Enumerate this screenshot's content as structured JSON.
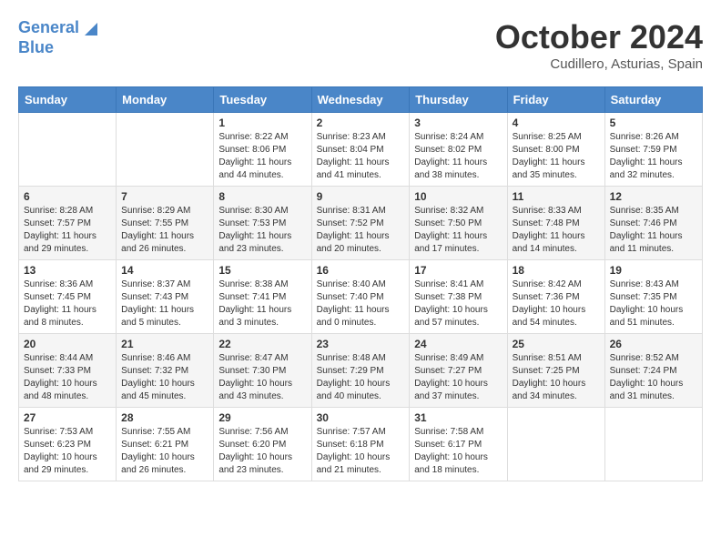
{
  "header": {
    "logo_line1": "General",
    "logo_line2": "Blue",
    "month_title": "October 2024",
    "location": "Cudillero, Asturias, Spain"
  },
  "days_of_week": [
    "Sunday",
    "Monday",
    "Tuesday",
    "Wednesday",
    "Thursday",
    "Friday",
    "Saturday"
  ],
  "weeks": [
    [
      {
        "day": "",
        "info": ""
      },
      {
        "day": "",
        "info": ""
      },
      {
        "day": "1",
        "info": "Sunrise: 8:22 AM\nSunset: 8:06 PM\nDaylight: 11 hours and 44 minutes."
      },
      {
        "day": "2",
        "info": "Sunrise: 8:23 AM\nSunset: 8:04 PM\nDaylight: 11 hours and 41 minutes."
      },
      {
        "day": "3",
        "info": "Sunrise: 8:24 AM\nSunset: 8:02 PM\nDaylight: 11 hours and 38 minutes."
      },
      {
        "day": "4",
        "info": "Sunrise: 8:25 AM\nSunset: 8:00 PM\nDaylight: 11 hours and 35 minutes."
      },
      {
        "day": "5",
        "info": "Sunrise: 8:26 AM\nSunset: 7:59 PM\nDaylight: 11 hours and 32 minutes."
      }
    ],
    [
      {
        "day": "6",
        "info": "Sunrise: 8:28 AM\nSunset: 7:57 PM\nDaylight: 11 hours and 29 minutes."
      },
      {
        "day": "7",
        "info": "Sunrise: 8:29 AM\nSunset: 7:55 PM\nDaylight: 11 hours and 26 minutes."
      },
      {
        "day": "8",
        "info": "Sunrise: 8:30 AM\nSunset: 7:53 PM\nDaylight: 11 hours and 23 minutes."
      },
      {
        "day": "9",
        "info": "Sunrise: 8:31 AM\nSunset: 7:52 PM\nDaylight: 11 hours and 20 minutes."
      },
      {
        "day": "10",
        "info": "Sunrise: 8:32 AM\nSunset: 7:50 PM\nDaylight: 11 hours and 17 minutes."
      },
      {
        "day": "11",
        "info": "Sunrise: 8:33 AM\nSunset: 7:48 PM\nDaylight: 11 hours and 14 minutes."
      },
      {
        "day": "12",
        "info": "Sunrise: 8:35 AM\nSunset: 7:46 PM\nDaylight: 11 hours and 11 minutes."
      }
    ],
    [
      {
        "day": "13",
        "info": "Sunrise: 8:36 AM\nSunset: 7:45 PM\nDaylight: 11 hours and 8 minutes."
      },
      {
        "day": "14",
        "info": "Sunrise: 8:37 AM\nSunset: 7:43 PM\nDaylight: 11 hours and 5 minutes."
      },
      {
        "day": "15",
        "info": "Sunrise: 8:38 AM\nSunset: 7:41 PM\nDaylight: 11 hours and 3 minutes."
      },
      {
        "day": "16",
        "info": "Sunrise: 8:40 AM\nSunset: 7:40 PM\nDaylight: 11 hours and 0 minutes."
      },
      {
        "day": "17",
        "info": "Sunrise: 8:41 AM\nSunset: 7:38 PM\nDaylight: 10 hours and 57 minutes."
      },
      {
        "day": "18",
        "info": "Sunrise: 8:42 AM\nSunset: 7:36 PM\nDaylight: 10 hours and 54 minutes."
      },
      {
        "day": "19",
        "info": "Sunrise: 8:43 AM\nSunset: 7:35 PM\nDaylight: 10 hours and 51 minutes."
      }
    ],
    [
      {
        "day": "20",
        "info": "Sunrise: 8:44 AM\nSunset: 7:33 PM\nDaylight: 10 hours and 48 minutes."
      },
      {
        "day": "21",
        "info": "Sunrise: 8:46 AM\nSunset: 7:32 PM\nDaylight: 10 hours and 45 minutes."
      },
      {
        "day": "22",
        "info": "Sunrise: 8:47 AM\nSunset: 7:30 PM\nDaylight: 10 hours and 43 minutes."
      },
      {
        "day": "23",
        "info": "Sunrise: 8:48 AM\nSunset: 7:29 PM\nDaylight: 10 hours and 40 minutes."
      },
      {
        "day": "24",
        "info": "Sunrise: 8:49 AM\nSunset: 7:27 PM\nDaylight: 10 hours and 37 minutes."
      },
      {
        "day": "25",
        "info": "Sunrise: 8:51 AM\nSunset: 7:25 PM\nDaylight: 10 hours and 34 minutes."
      },
      {
        "day": "26",
        "info": "Sunrise: 8:52 AM\nSunset: 7:24 PM\nDaylight: 10 hours and 31 minutes."
      }
    ],
    [
      {
        "day": "27",
        "info": "Sunrise: 7:53 AM\nSunset: 6:23 PM\nDaylight: 10 hours and 29 minutes."
      },
      {
        "day": "28",
        "info": "Sunrise: 7:55 AM\nSunset: 6:21 PM\nDaylight: 10 hours and 26 minutes."
      },
      {
        "day": "29",
        "info": "Sunrise: 7:56 AM\nSunset: 6:20 PM\nDaylight: 10 hours and 23 minutes."
      },
      {
        "day": "30",
        "info": "Sunrise: 7:57 AM\nSunset: 6:18 PM\nDaylight: 10 hours and 21 minutes."
      },
      {
        "day": "31",
        "info": "Sunrise: 7:58 AM\nSunset: 6:17 PM\nDaylight: 10 hours and 18 minutes."
      },
      {
        "day": "",
        "info": ""
      },
      {
        "day": "",
        "info": ""
      }
    ]
  ]
}
